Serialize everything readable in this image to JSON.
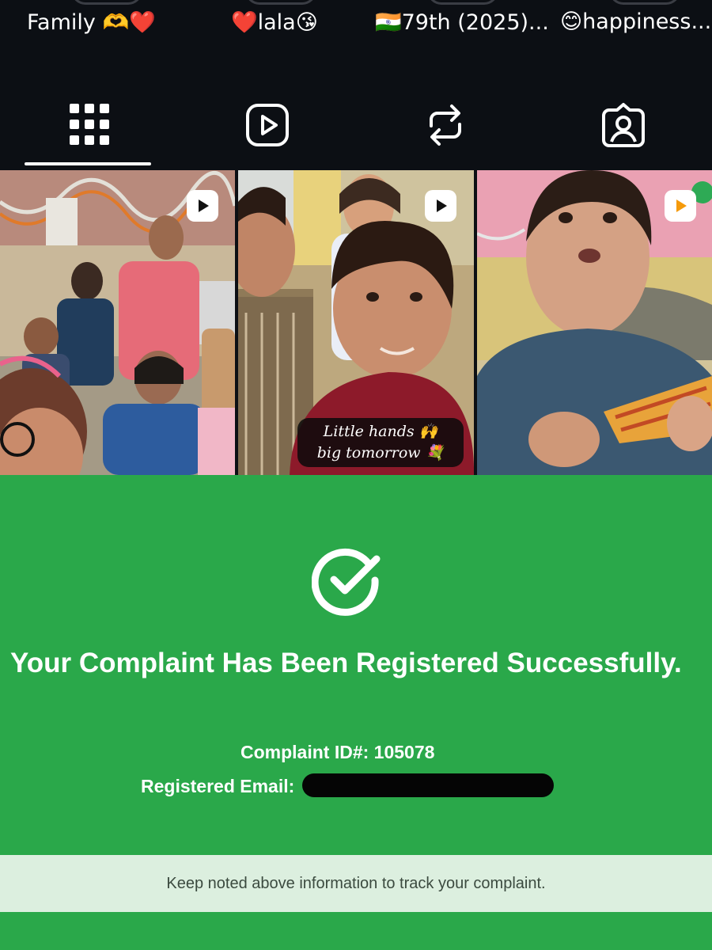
{
  "highlights": [
    {
      "label": "Family 🫶❤️"
    },
    {
      "label": "❤️lala😘"
    },
    {
      "label": "🇮🇳79th (2025)..."
    },
    {
      "label": "😊happiness..."
    }
  ],
  "tabs": [
    {
      "name": "posts-grid",
      "icon": "grid-icon",
      "active": true
    },
    {
      "name": "reels",
      "icon": "reels-icon",
      "active": false
    },
    {
      "name": "reposts",
      "icon": "repost-icon",
      "active": false
    },
    {
      "name": "tagged",
      "icon": "tagged-icon",
      "active": false
    }
  ],
  "grid": {
    "posts": [
      {
        "type": "reel",
        "icon": "play-icon",
        "caption": ""
      },
      {
        "type": "reel",
        "icon": "play-icon",
        "caption": "Little hands 🙌 big tomorrow 💐"
      },
      {
        "type": "reel",
        "icon": "play-icon",
        "caption": ""
      }
    ]
  },
  "success": {
    "icon": "check-circle-icon",
    "title": "Your Complaint Has Been Registered Successfully.",
    "complaint_id_label": "Complaint ID#:",
    "complaint_id": "105078",
    "email_label": "Registered Email:",
    "notice": "Keep noted above information to track your complaint."
  },
  "colors": {
    "background_dark": "#0c0f14",
    "success_green": "#2aa84a",
    "notice_bg": "#dcefdf",
    "reel_icon_orange": "#f59a0b"
  }
}
